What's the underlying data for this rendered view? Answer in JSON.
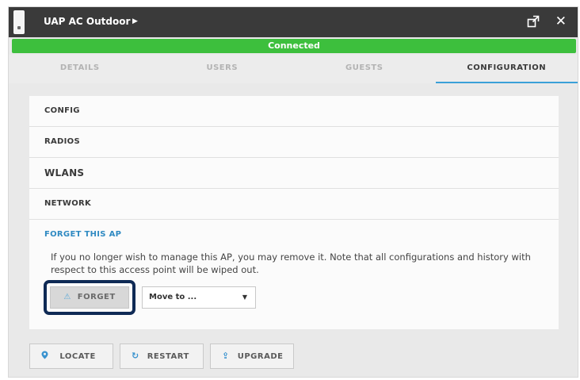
{
  "window": {
    "title": "UAP AC Outdoor",
    "title_caret": "▶",
    "status": "Connected",
    "status_color": "#3dbf3d",
    "accent_color": "#3aa0d8",
    "close_symbol": "✕"
  },
  "tabs": [
    {
      "label": "DETAILS",
      "active": false
    },
    {
      "label": "USERS",
      "active": false
    },
    {
      "label": "GUESTS",
      "active": false
    },
    {
      "label": "CONFIGURATION",
      "active": true
    }
  ],
  "config_sections": [
    {
      "label": "CONFIG"
    },
    {
      "label": "RADIOS"
    },
    {
      "label": "WLANS"
    },
    {
      "label": "NETWORK"
    }
  ],
  "forget": {
    "title": "FORGET THIS AP",
    "description": "If you no longer wish to manage this AP, you may remove it. Note that all configurations and history with respect to this access point will be wiped out.",
    "button_label": "FORGET",
    "button_icon": "forget-icon",
    "move_select_value": "Move to ..."
  },
  "actions": [
    {
      "label": "LOCATE",
      "icon": "location-pin-icon"
    },
    {
      "label": "RESTART",
      "icon": "restart-icon"
    },
    {
      "label": "UPGRADE",
      "icon": "upgrade-icon"
    }
  ]
}
